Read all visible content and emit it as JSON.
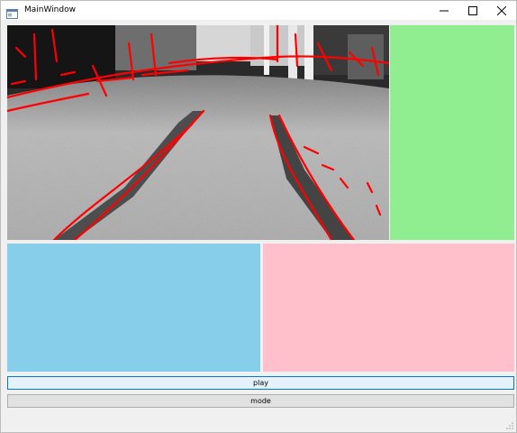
{
  "window": {
    "title": "MainWindow",
    "icon": "window-app-icon",
    "controls": [
      "minimize-icon",
      "maximize-icon",
      "close-icon"
    ]
  },
  "camera_view": {
    "content": "grayscale carpet floor with two dark tape lane lines and red edge-detection overlay"
  },
  "panels": {
    "green": {
      "color": "#90ee90"
    },
    "blue": {
      "color": "#87ceeb"
    },
    "pink": {
      "color": "#ffc0cb"
    }
  },
  "buttons": {
    "play_label": "play",
    "mode_label": "mode"
  },
  "colors": {
    "edge_overlay": "#ff0000",
    "focus_border": "#0078d7"
  }
}
